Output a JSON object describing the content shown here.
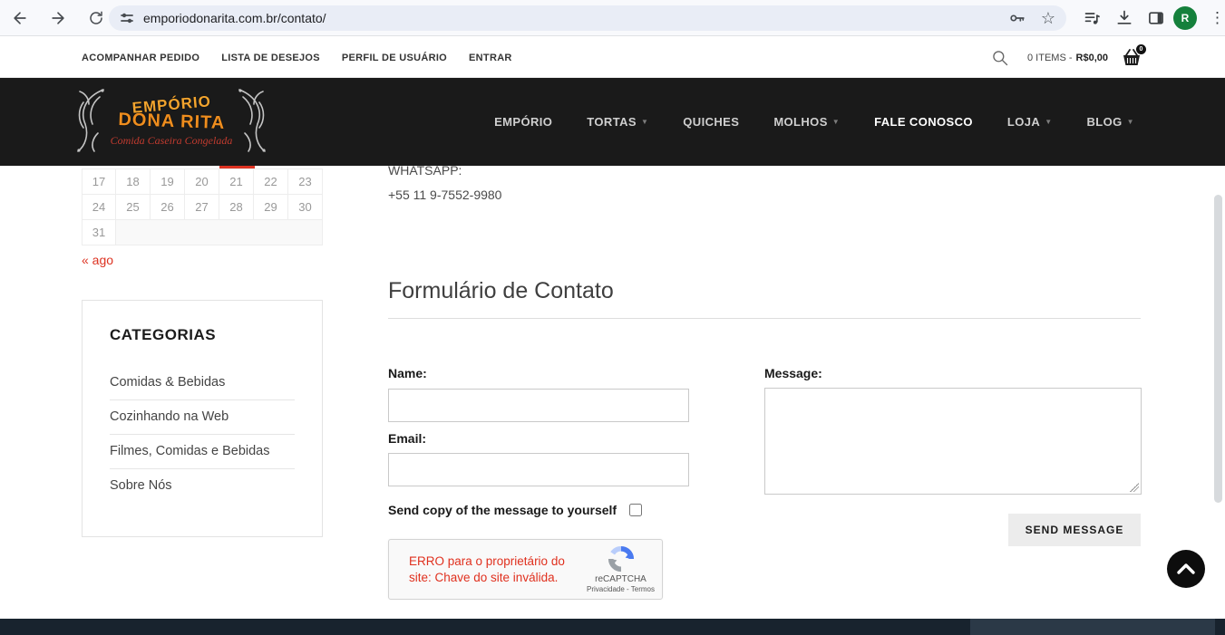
{
  "browser": {
    "url": "emporiodonarita.com.br/contato/",
    "avatar_letter": "R",
    "kebab": "⋮",
    "star": "☆"
  },
  "topbar": {
    "links": [
      "ACOMPANHAR PEDIDO",
      "LISTA DE DESEJOS",
      "PERFIL DE USUÁRIO",
      "ENTRAR"
    ],
    "cart_items_text": "0 ITEMS -",
    "cart_amount": "R$0,00",
    "cart_badge": "0"
  },
  "logo": {
    "line1": "EMPÓRIO",
    "line2": "DONA RITA",
    "tagline": "Comida Caseira Congelada"
  },
  "nav": {
    "items": [
      {
        "label": "EMPÓRIO"
      },
      {
        "label": "TORTAS"
      },
      {
        "label": "QUICHES"
      },
      {
        "label": "MOLHOS"
      },
      {
        "label": "FALE CONOSCO"
      },
      {
        "label": "LOJA"
      },
      {
        "label": "BLOG"
      }
    ],
    "caret": "▼"
  },
  "sidebar": {
    "calendar": {
      "rows": [
        [
          "17",
          "18",
          "19",
          "20",
          "21",
          "22",
          "23"
        ],
        [
          "24",
          "25",
          "26",
          "27",
          "28",
          "29",
          "30"
        ],
        [
          "31"
        ]
      ],
      "highlighted_day": "21",
      "prev_link": "« ago"
    },
    "categories": {
      "title": "CATEGORIAS",
      "items": [
        "Comidas & Bebidas",
        "Cozinhando na Web",
        "Filmes, Comidas e Bebidas",
        "Sobre Nós"
      ]
    }
  },
  "main": {
    "whatsapp_label": "WHATSAPP:",
    "whatsapp_number": "+55 11 9-7552-9980",
    "form_title": "Formulário de Contato",
    "name_label": "Name:",
    "email_label": "Email:",
    "message_label": "Message:",
    "copy_label": "Send copy of the message to yourself",
    "send_button": "SEND MESSAGE",
    "recaptcha_error": "ERRO para o proprietário do site: Chave do site inválida.",
    "recaptcha_brand": "reCAPTCHA",
    "recaptcha_links": "Privacidade - Termos"
  },
  "colors": {
    "accent_red": "#dd3322",
    "header_bg": "#1a1a1a",
    "footer_bg": "#18232e",
    "logo_orange1": "#f2a42e",
    "logo_orange2": "#ee8d1e",
    "logo_red": "#c23b2f",
    "avatar_green": "#15803c",
    "error_red": "#e0301e"
  }
}
